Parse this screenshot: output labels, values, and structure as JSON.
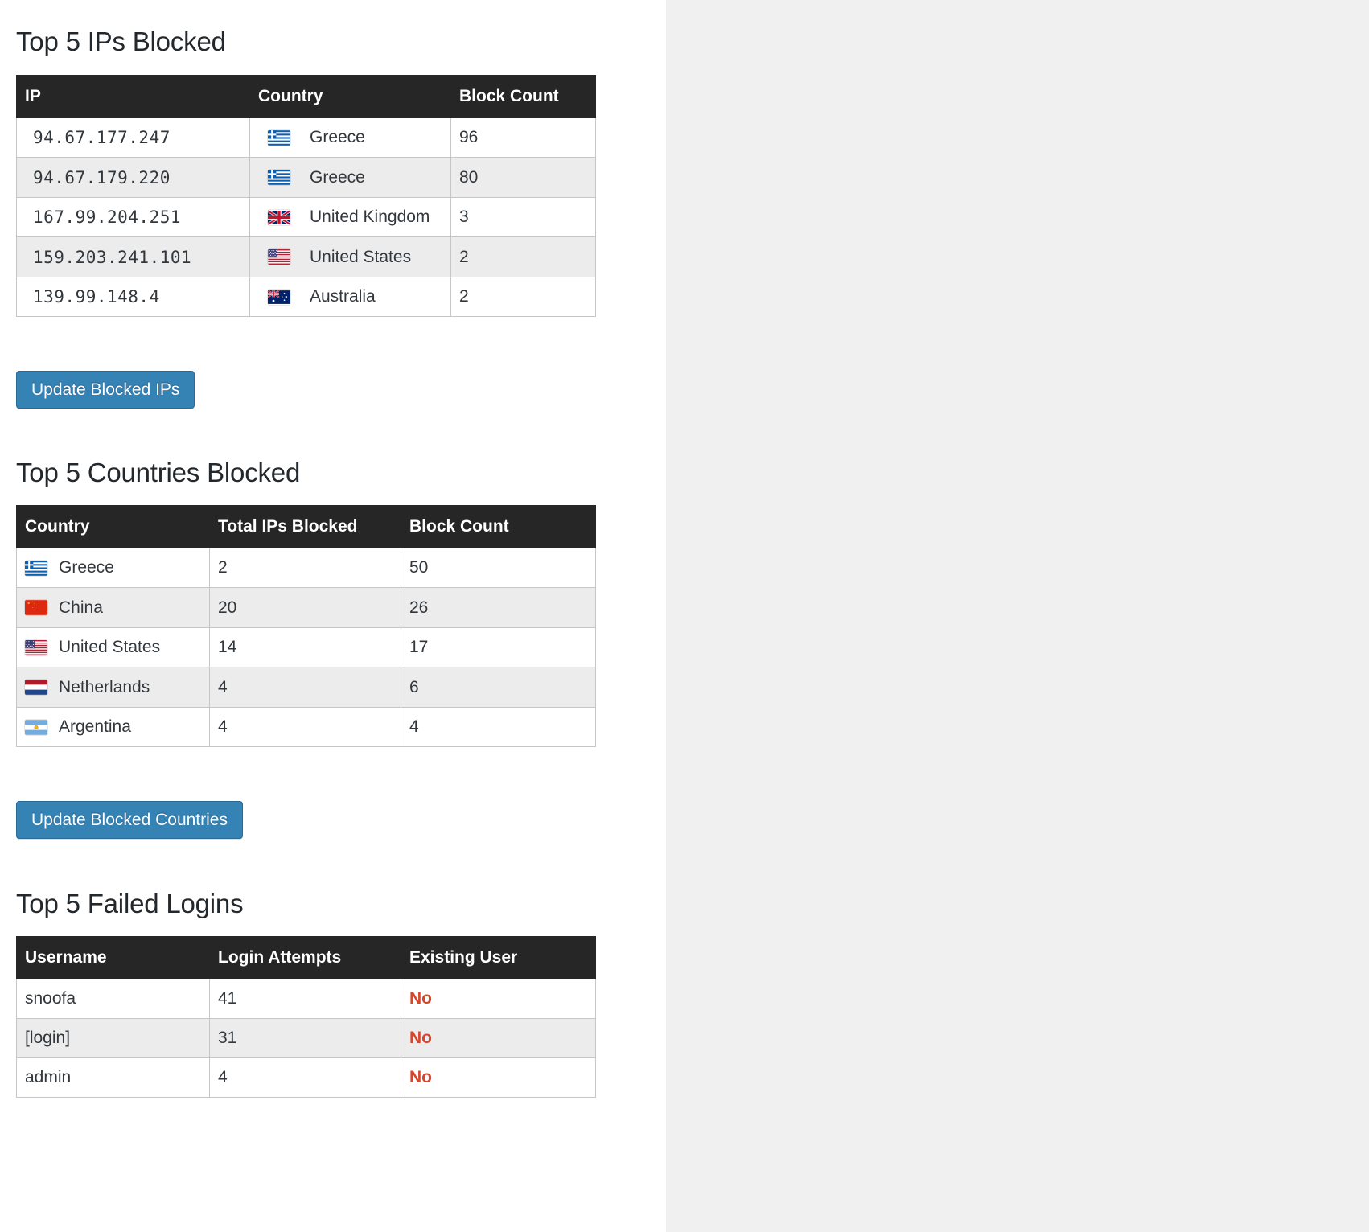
{
  "theme": {
    "page_background": "#f0f0f0",
    "content_background": "#ffffff",
    "table_header_bg": "#262626",
    "table_header_text": "#ffffff",
    "row_alt_bg": "#ececec",
    "border_color": "#c6c6c6",
    "button_bg": "#3582b5",
    "negative_text": "#d9452b",
    "body_text": "#32373c"
  },
  "sections": {
    "ips": {
      "title": "Top 5 IPs Blocked",
      "columns": [
        "IP",
        "Country",
        "Block Count"
      ],
      "rows": [
        {
          "ip": "94.67.177.247",
          "country": "Greece",
          "flag": "flag-greece",
          "block_count": "96"
        },
        {
          "ip": "94.67.179.220",
          "country": "Greece",
          "flag": "flag-greece",
          "block_count": "80"
        },
        {
          "ip": "167.99.204.251",
          "country": "United Kingdom",
          "flag": "flag-united-kingdom",
          "block_count": "3"
        },
        {
          "ip": "159.203.241.101",
          "country": "United States",
          "flag": "flag-united-states",
          "block_count": "2"
        },
        {
          "ip": "139.99.148.4",
          "country": "Australia",
          "flag": "flag-australia",
          "block_count": "2"
        }
      ],
      "button_label": "Update Blocked IPs"
    },
    "countries": {
      "title": "Top 5 Countries Blocked",
      "columns": [
        "Country",
        "Total IPs Blocked",
        "Block Count"
      ],
      "rows": [
        {
          "country": "Greece",
          "flag": "flag-greece",
          "total_ips_blocked": "2",
          "block_count": "50"
        },
        {
          "country": "China",
          "flag": "flag-china",
          "total_ips_blocked": "20",
          "block_count": "26"
        },
        {
          "country": "United States",
          "flag": "flag-united-states",
          "total_ips_blocked": "14",
          "block_count": "17"
        },
        {
          "country": "Netherlands",
          "flag": "flag-netherlands",
          "total_ips_blocked": "4",
          "block_count": "6"
        },
        {
          "country": "Argentina",
          "flag": "flag-argentina",
          "total_ips_blocked": "4",
          "block_count": "4"
        }
      ],
      "button_label": "Update Blocked Countries"
    },
    "logins": {
      "title": "Top 5 Failed Logins",
      "columns": [
        "Username",
        "Login Attempts",
        "Existing User"
      ],
      "rows": [
        {
          "username": "snoofa",
          "login_attempts": "41",
          "existing_user": "No"
        },
        {
          "username": "[login]",
          "login_attempts": "31",
          "existing_user": "No"
        },
        {
          "username": "admin",
          "login_attempts": "4",
          "existing_user": "No"
        }
      ]
    }
  }
}
